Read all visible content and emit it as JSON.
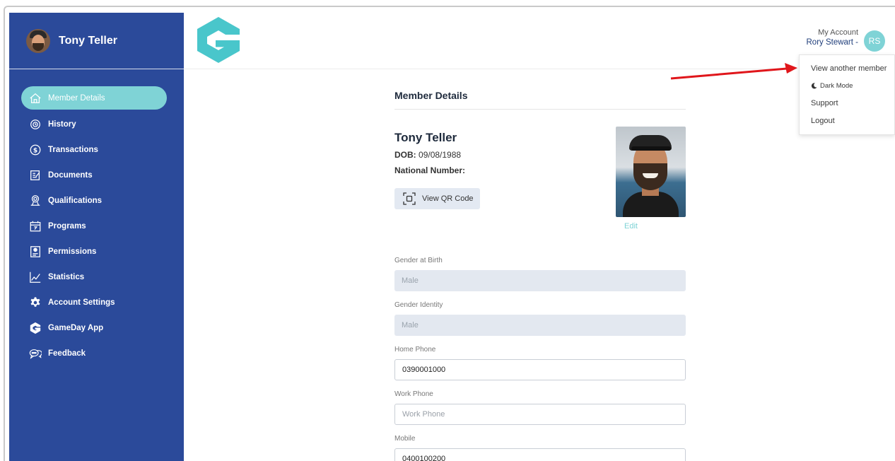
{
  "sidebar": {
    "user_name": "Tony Teller",
    "items": [
      {
        "label": "Member Details",
        "icon": "home-icon"
      },
      {
        "label": "History",
        "icon": "history-icon"
      },
      {
        "label": "Transactions",
        "icon": "dollar-icon"
      },
      {
        "label": "Documents",
        "icon": "document-icon"
      },
      {
        "label": "Qualifications",
        "icon": "qualification-icon"
      },
      {
        "label": "Programs",
        "icon": "calendar-icon"
      },
      {
        "label": "Permissions",
        "icon": "permissions-icon"
      },
      {
        "label": "Statistics",
        "icon": "statistics-icon"
      },
      {
        "label": "Account Settings",
        "icon": "gear-icon"
      },
      {
        "label": "GameDay App",
        "icon": "gameday-logo-icon"
      },
      {
        "label": "Feedback",
        "icon": "feedback-icon"
      }
    ]
  },
  "header": {
    "account_label": "My Account",
    "account_user": "Rory Stewart -",
    "avatar_initials": "RS"
  },
  "dropdown": {
    "items": [
      "View another member",
      "Dark Mode",
      "Support",
      "Logout"
    ]
  },
  "main": {
    "section_title": "Member Details",
    "member_name": "Tony Teller",
    "dob_label": "DOB:",
    "dob_value": "09/08/1988",
    "national_number_label": "National Number:",
    "qr_button_label": "View QR Code",
    "edit_label": "Edit",
    "fields": {
      "gender_birth": {
        "label": "Gender at Birth",
        "value": "Male"
      },
      "gender_identity": {
        "label": "Gender Identity",
        "value": "Male"
      },
      "home_phone": {
        "label": "Home Phone",
        "value": "0390001000"
      },
      "work_phone": {
        "label": "Work Phone",
        "placeholder": "Work Phone"
      },
      "mobile": {
        "label": "Mobile",
        "value": "0400100200"
      }
    }
  },
  "colors": {
    "sidebar_bg": "#2b4a9a",
    "accent_teal": "#7fd3d6",
    "annotation_arrow": "#e0161b"
  }
}
